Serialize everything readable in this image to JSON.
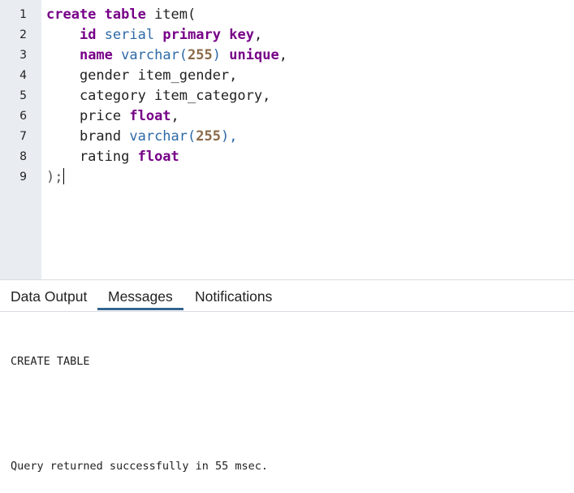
{
  "editor": {
    "line_numbers": [
      "1",
      "2",
      "3",
      "4",
      "5",
      "6",
      "7",
      "8",
      "9"
    ],
    "lines": [
      [
        {
          "t": "create table ",
          "c": "kw"
        },
        {
          "t": "item(",
          "c": "plain"
        }
      ],
      [
        {
          "t": "    ",
          "c": "plain"
        },
        {
          "t": "id",
          "c": "kw"
        },
        {
          "t": " ",
          "c": "plain"
        },
        {
          "t": "serial",
          "c": "type"
        },
        {
          "t": " ",
          "c": "plain"
        },
        {
          "t": "primary key",
          "c": "kw"
        },
        {
          "t": ",",
          "c": "plain"
        }
      ],
      [
        {
          "t": "    ",
          "c": "plain"
        },
        {
          "t": "name",
          "c": "kw"
        },
        {
          "t": " ",
          "c": "plain"
        },
        {
          "t": "varchar(",
          "c": "type"
        },
        {
          "t": "255",
          "c": "num"
        },
        {
          "t": ")",
          "c": "type"
        },
        {
          "t": " ",
          "c": "plain"
        },
        {
          "t": "unique",
          "c": "kw"
        },
        {
          "t": ",",
          "c": "plain"
        }
      ],
      [
        {
          "t": "    gender item_gender,",
          "c": "plain"
        }
      ],
      [
        {
          "t": "    category item_category,",
          "c": "plain"
        }
      ],
      [
        {
          "t": "    price ",
          "c": "plain"
        },
        {
          "t": "float",
          "c": "kw"
        },
        {
          "t": ",",
          "c": "plain"
        }
      ],
      [
        {
          "t": "    brand ",
          "c": "plain"
        },
        {
          "t": "varchar(",
          "c": "type"
        },
        {
          "t": "255",
          "c": "num"
        },
        {
          "t": "),",
          "c": "type"
        }
      ],
      [
        {
          "t": "    rating ",
          "c": "plain"
        },
        {
          "t": "float",
          "c": "kw"
        }
      ],
      [
        {
          "t": ");",
          "c": "punc"
        }
      ]
    ]
  },
  "tabs": {
    "data_output": "Data Output",
    "messages": "Messages",
    "notifications": "Notifications"
  },
  "messages": {
    "line1": "CREATE TABLE",
    "line2": "Query returned successfully in 55 msec."
  }
}
